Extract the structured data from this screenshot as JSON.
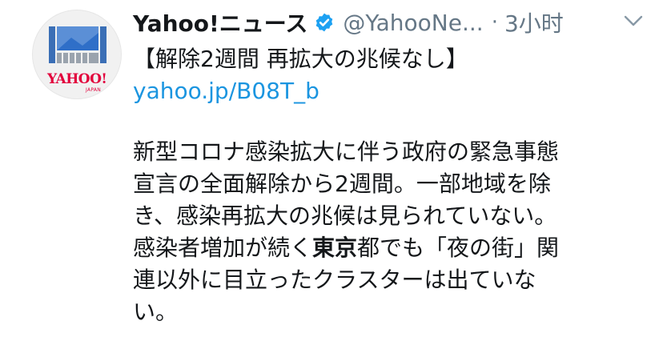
{
  "account": {
    "display_name": "Yahoo!ニュース",
    "handle": "@YahooNe...",
    "separator": "·",
    "time": "3小时",
    "avatar_logo": "YAHOO!",
    "avatar_logo_sub": "JAPAN",
    "verified_icon": "verified-badge-icon"
  },
  "tweet": {
    "headline": "【解除2週間 再拡大の兆候なし】",
    "link": "yahoo.jp/B08T_b",
    "body_lines": [
      [
        "新型コロナ感染拡大に伴う政府の緊急事態"
      ],
      [
        "宣言の全面解除から2週間。一部地域を除"
      ],
      [
        "き、感染再拡大の兆候は見られていない。"
      ],
      [
        "感染者増加が続く",
        "東京",
        "都でも「夜の街」関"
      ],
      [
        "連以外に目立ったクラスターは出ていな"
      ],
      [
        "い。"
      ]
    ]
  },
  "colors": {
    "link": "#1b95e0",
    "meta": "#657786",
    "verified": "#1da1f2",
    "brand_red": "#e2003b"
  }
}
